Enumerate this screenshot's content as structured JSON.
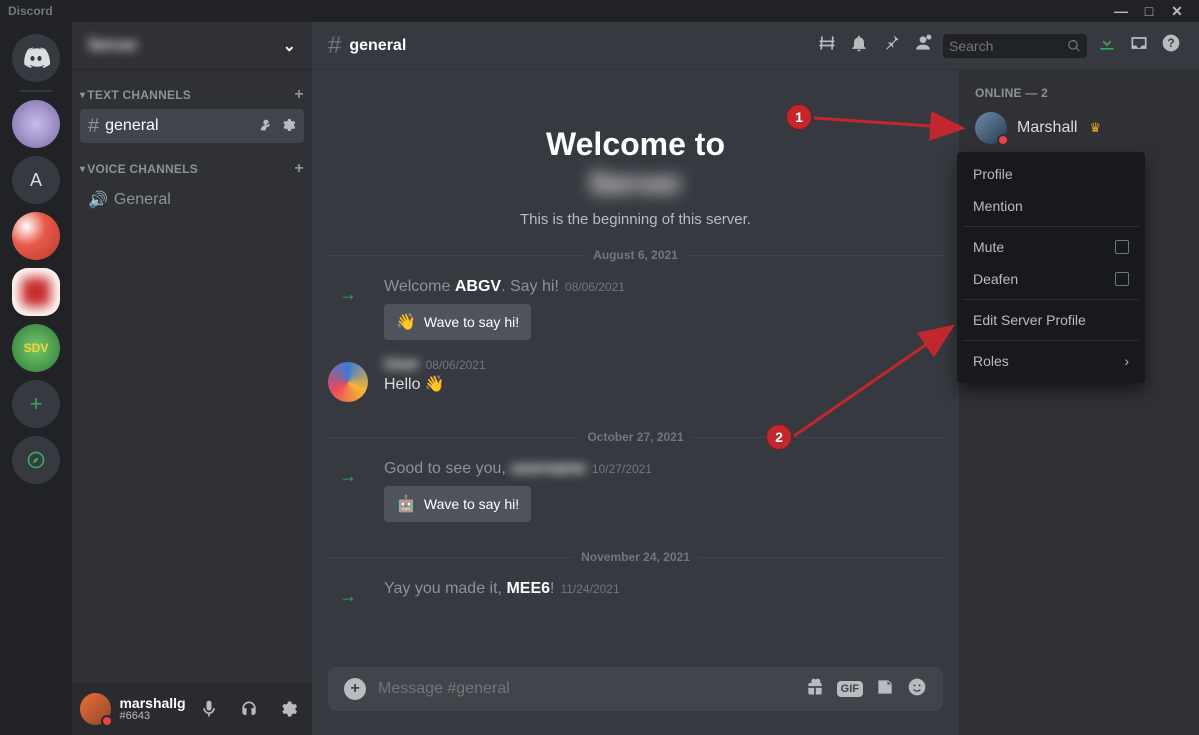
{
  "app_name": "Discord",
  "window": {
    "min": "—",
    "max": "□",
    "close": "✕"
  },
  "server_header": {
    "name": "Server",
    "chevron": "⌄"
  },
  "categories": {
    "text": {
      "label": "TEXT CHANNELS",
      "chev": "▾"
    },
    "voice": {
      "label": "VOICE CHANNELS",
      "chev": "▾"
    }
  },
  "channels": {
    "general": {
      "name": "general"
    },
    "voice_general": {
      "name": "General"
    }
  },
  "user_panel": {
    "name": "marshallg",
    "tag": "#6643"
  },
  "header": {
    "channel": "general",
    "search_placeholder": "Search"
  },
  "welcome": {
    "title": "Welcome to",
    "server": "Server",
    "subtitle": "This is the beginning of this server."
  },
  "dates": {
    "d1": "August 6, 2021",
    "d2": "October 27, 2021",
    "d3": "November 24, 2021"
  },
  "messages": {
    "m1": {
      "pre": "Welcome ",
      "bold": "ABGV",
      "post": ". Say hi!",
      "ts": "08/06/2021",
      "wave": "Wave to say hi!"
    },
    "m2": {
      "user": "User",
      "ts": "08/06/2021",
      "text": "Hello "
    },
    "m3": {
      "pre": "Good to see you,",
      "bold": "",
      "post": "",
      "ts": "10/27/2021",
      "wave": "Wave to say hi!"
    },
    "m4": {
      "pre": "Yay you made it, ",
      "bold": "MEE6",
      "post": "!",
      "ts": "11/24/2021"
    }
  },
  "composer": {
    "placeholder": "Message #general",
    "gif": "GIF"
  },
  "members": {
    "header": "Online — 2",
    "u1": {
      "name": "Marshall"
    }
  },
  "context_menu": {
    "profile": "Profile",
    "mention": "Mention",
    "mute": "Mute",
    "deafen": "Deafen",
    "edit": "Edit Server Profile",
    "roles": "Roles"
  },
  "annotations": {
    "a1": "1",
    "a2": "2"
  }
}
